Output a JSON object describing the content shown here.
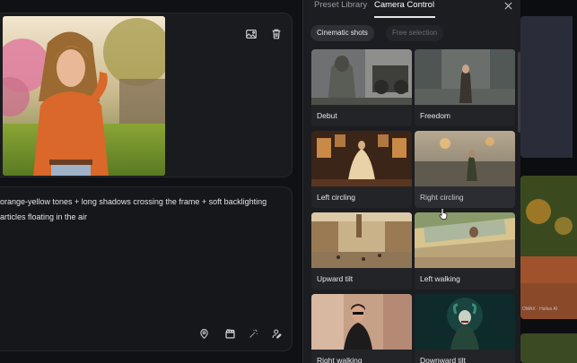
{
  "editor": {
    "prompt_lines": [
      " orange-yellow tones + long shadows crossing the frame + soft backlighting",
      "articles floating in the air"
    ],
    "card_tools": [
      "image-replace-icon",
      "trash-icon"
    ],
    "bottom_tools": [
      "location-pin-icon",
      "clapperboard-icon",
      "magic-wand-icon",
      "person-edit-icon"
    ]
  },
  "panel": {
    "tabs": [
      {
        "label": "Preset Library",
        "active": false
      },
      {
        "label": "Camera Control",
        "active": true
      }
    ],
    "filters": [
      {
        "label": "Cinematic shots",
        "active": true
      },
      {
        "label": "Free selection",
        "active": false
      }
    ],
    "presets": [
      {
        "label": "Debut"
      },
      {
        "label": "Freedom"
      },
      {
        "label": "Left circling"
      },
      {
        "label": "Right circling",
        "hovered": true
      },
      {
        "label": "Upward tilt"
      },
      {
        "label": "Left walking"
      },
      {
        "label": "Right walking"
      },
      {
        "label": "Downward tilt"
      }
    ]
  },
  "right_column": {
    "watermark": "OMAX · Hailuo AI"
  },
  "colors": {
    "background": "#101114",
    "panel": "#1c1d21",
    "tile": "#232428",
    "accent_photo": "#d9682a"
  }
}
